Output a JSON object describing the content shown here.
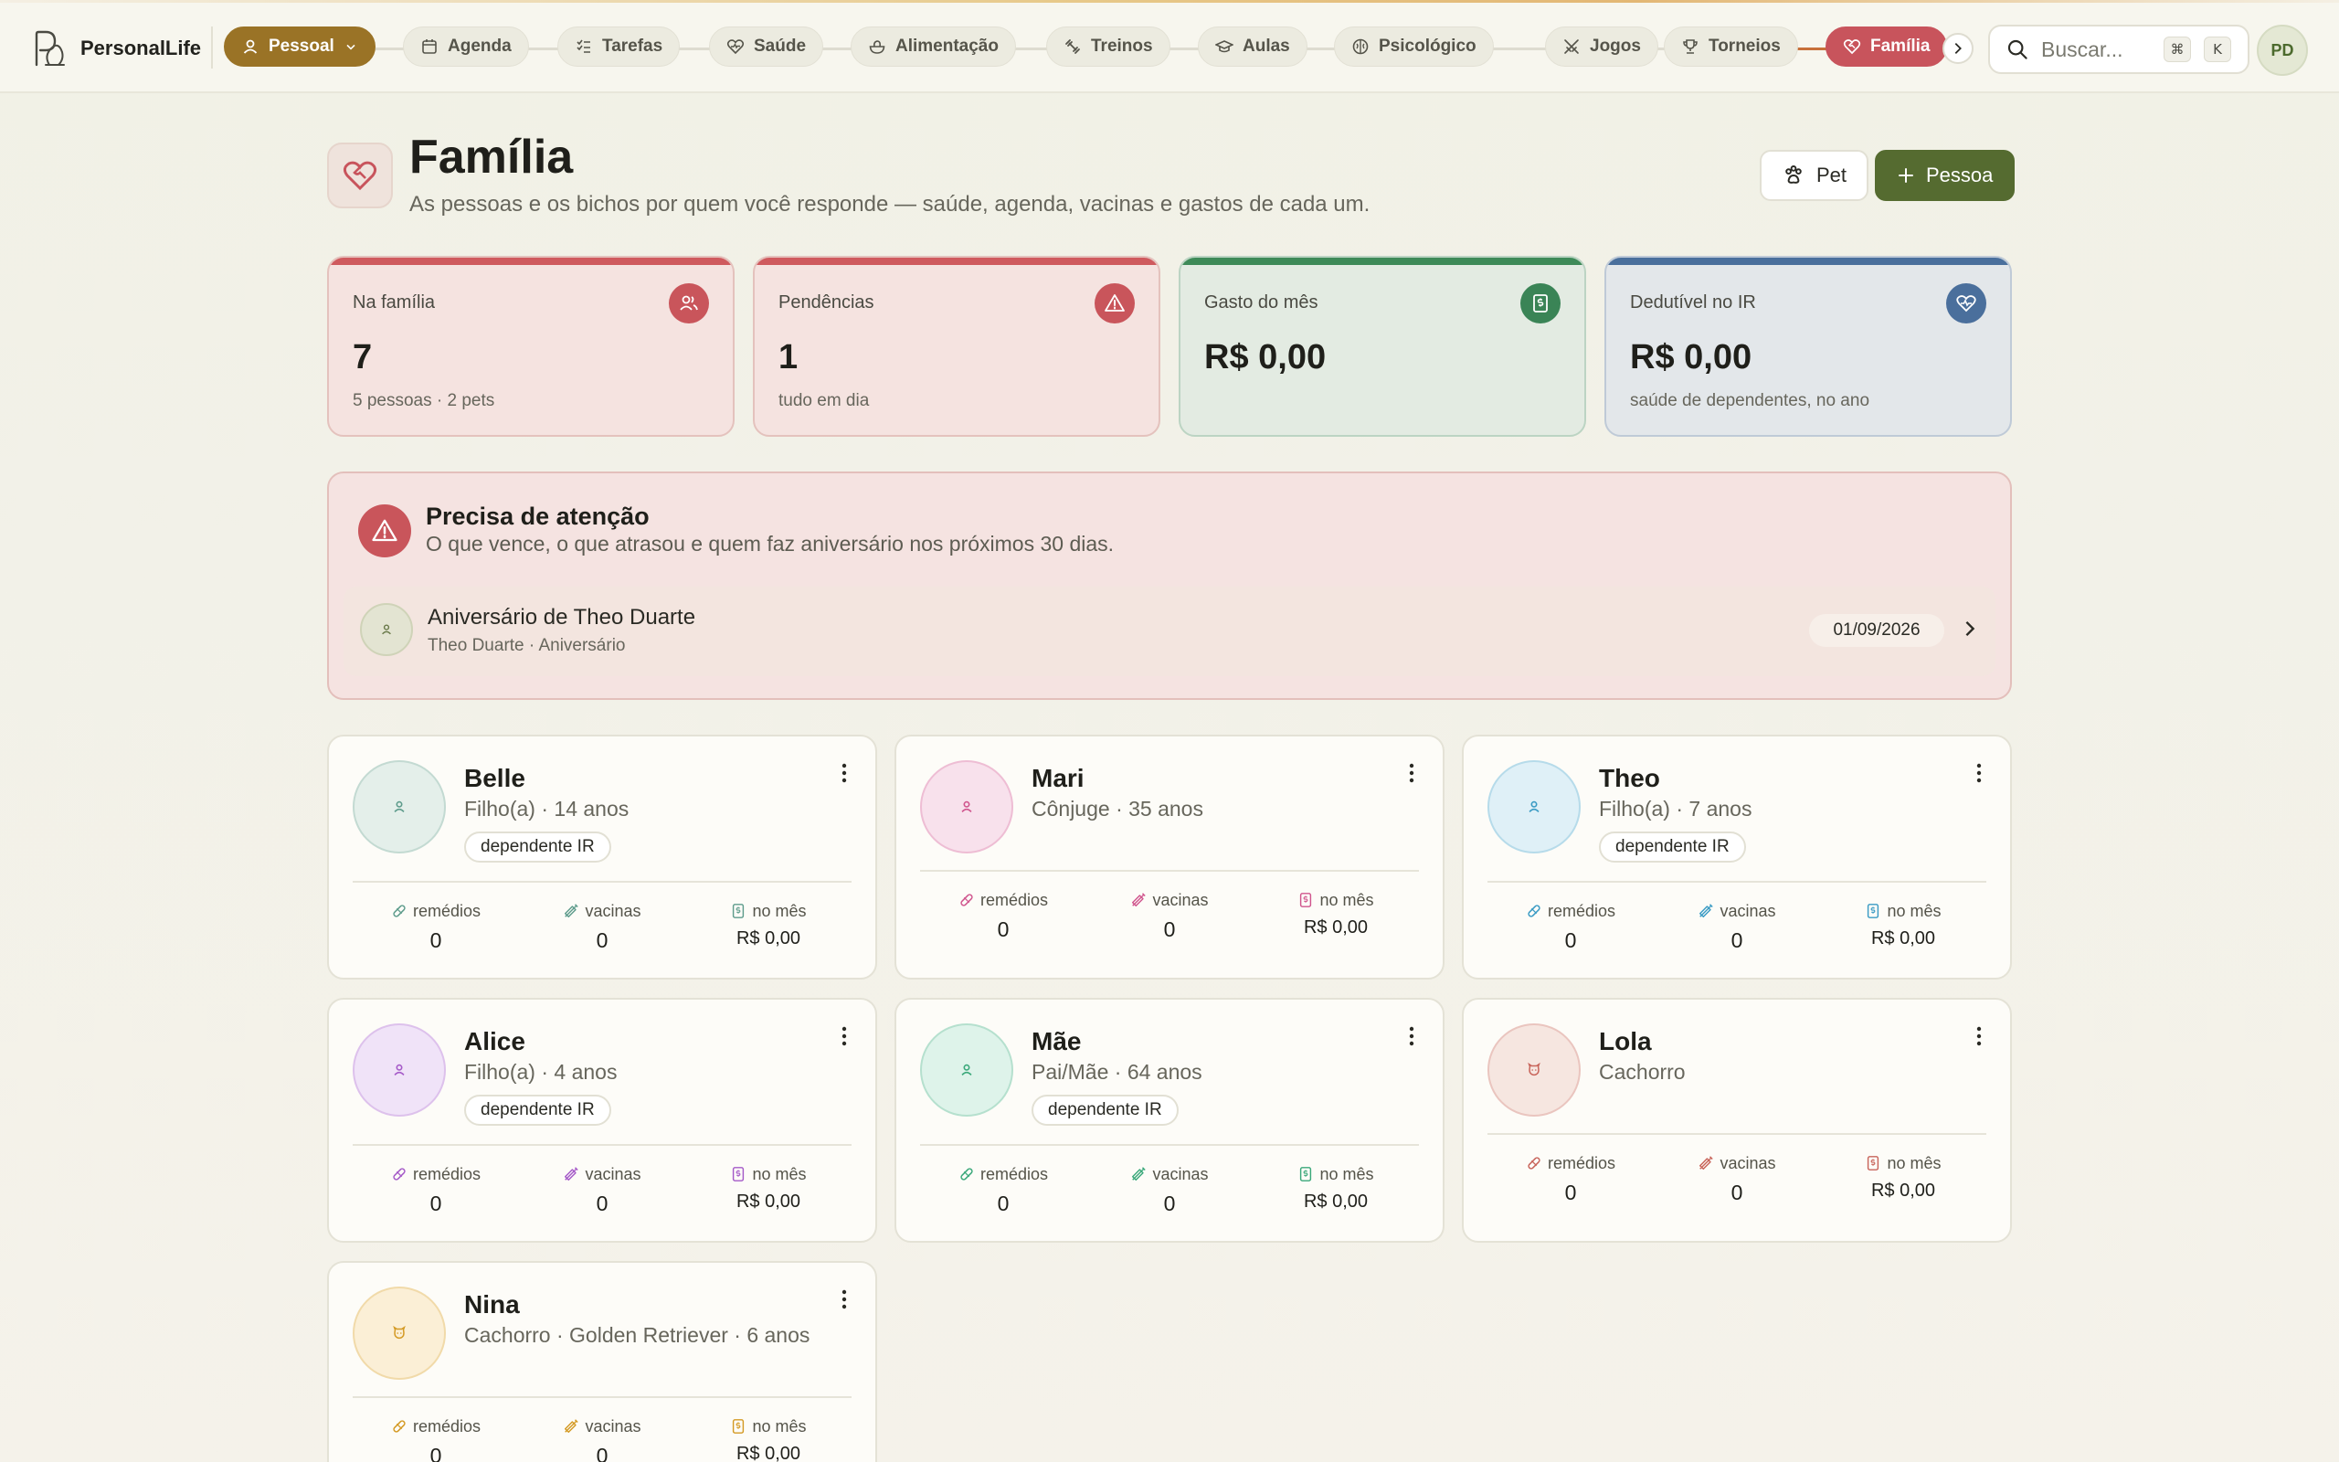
{
  "app": {
    "name": "PersonalLife",
    "user_initials": "PD"
  },
  "nav": {
    "primary": "Pessoal",
    "items": [
      {
        "label": "Agenda",
        "icon": "calendar-icon"
      },
      {
        "label": "Tarefas",
        "icon": "list-check-icon"
      },
      {
        "label": "Saúde",
        "icon": "heart-pulse-icon"
      },
      {
        "label": "Alimentação",
        "icon": "salad-icon"
      },
      {
        "label": "Treinos",
        "icon": "dumbbell-icon"
      },
      {
        "label": "Aulas",
        "icon": "graduation-cap-icon"
      },
      {
        "label": "Psicológico",
        "icon": "brain-icon"
      },
      {
        "label": "Jogos",
        "icon": "swords-icon"
      },
      {
        "label": "Torneios",
        "icon": "trophy-icon"
      },
      {
        "label": "Família",
        "icon": "heart-handshake-icon",
        "active": true
      }
    ],
    "search_placeholder": "Buscar...",
    "shortcut_keys": [
      "⌘",
      "K"
    ]
  },
  "page": {
    "title": "Família",
    "subtitle": "As pessoas e os bichos por quem você responde — saúde, agenda, vacinas e gastos de cada um.",
    "btn_pet": "Pet",
    "btn_pessoa": "Pessoa"
  },
  "stats": [
    {
      "label": "Na família",
      "value": "7",
      "note": "5 pessoas · 2 pets",
      "color": "#cf5a5e",
      "icon": "users-icon"
    },
    {
      "label": "Pendências",
      "value": "1",
      "note": "tudo em dia",
      "color": "#cf5a5e",
      "icon": "alert-triangle-icon"
    },
    {
      "label": "Gasto do mês",
      "value": "R$ 0,00",
      "note": "",
      "color": "#3e8a58",
      "icon": "receipt-icon"
    },
    {
      "label": "Dedutível no IR",
      "value": "R$ 0,00",
      "note": "saúde de dependentes, no ano",
      "color": "#4a6f9c",
      "icon": "heart-pulse-icon"
    }
  ],
  "attention": {
    "title": "Precisa de atenção",
    "subtitle": "O que vence, o que atrasou e quem faz aniversário nos próximos 30 dias.",
    "items": [
      {
        "title": "Aniversário de Theo Duarte",
        "sub": "Theo Duarte · Aniversário",
        "date": "01/09/2026"
      }
    ]
  },
  "metric_labels": {
    "meds": "remédios",
    "vaccines": "vacinas",
    "month": "no mês"
  },
  "members": [
    {
      "name": "Belle",
      "meta": "Filho(a) · 14 anos",
      "tag": "dependente IR",
      "meds": "0",
      "vaccines": "0",
      "month": "R$ 0,00",
      "color": "#5e9c8c",
      "bg": "#e4efea",
      "kind": "person"
    },
    {
      "name": "Mari",
      "meta": "Cônjuge · 35 anos",
      "tag": "",
      "meds": "0",
      "vaccines": "0",
      "month": "R$ 0,00",
      "color": "#d0558d",
      "bg": "#f8e1ec",
      "kind": "person"
    },
    {
      "name": "Theo",
      "meta": "Filho(a) · 7 anos",
      "tag": "dependente IR",
      "meds": "0",
      "vaccines": "0",
      "month": "R$ 0,00",
      "color": "#3a9bc4",
      "bg": "#dff0f7",
      "kind": "person"
    },
    {
      "name": "Alice",
      "meta": "Filho(a) · 4 anos",
      "tag": "dependente IR",
      "meds": "0",
      "vaccines": "0",
      "month": "R$ 0,00",
      "color": "#a55ac8",
      "bg": "#f0e3f8",
      "kind": "person"
    },
    {
      "name": "Mãe",
      "meta": "Pai/Mãe · 64 anos",
      "tag": "dependente IR",
      "meds": "0",
      "vaccines": "0",
      "month": "R$ 0,00",
      "color": "#3aa87a",
      "bg": "#def3ea",
      "kind": "person"
    },
    {
      "name": "Lola",
      "meta": "Cachorro",
      "tag": "",
      "meds": "0",
      "vaccines": "0",
      "month": "R$ 0,00",
      "color": "#c8645a",
      "bg": "#f6e6e0",
      "kind": "pet"
    },
    {
      "name": "Nina",
      "meta": "Cachorro · Golden Retriever · 6 anos",
      "tag": "",
      "meds": "0",
      "vaccines": "0",
      "month": "R$ 0,00",
      "color": "#d49a24",
      "bg": "#fbefd6",
      "kind": "pet"
    }
  ]
}
